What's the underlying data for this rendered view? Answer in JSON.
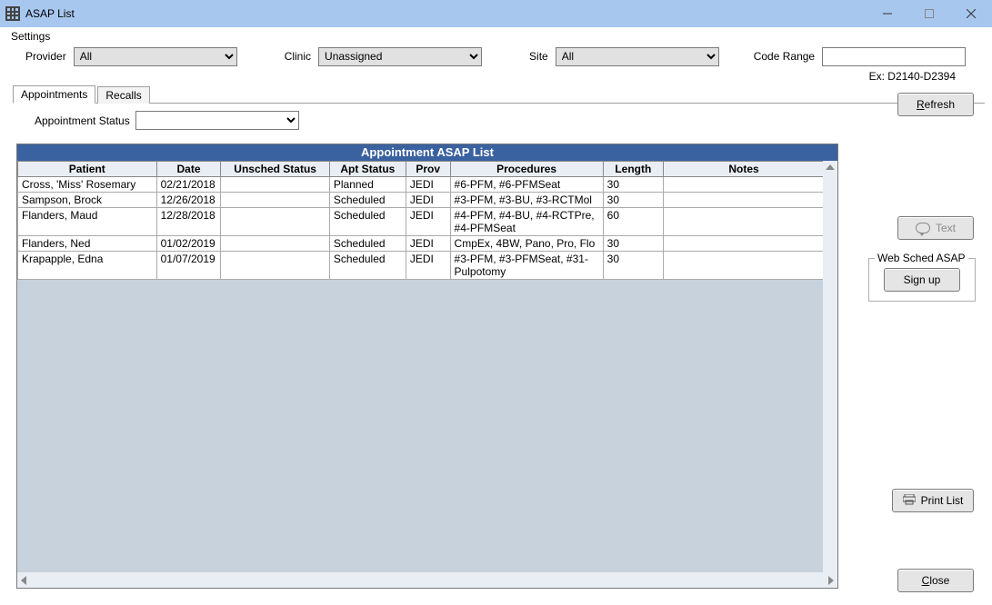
{
  "window": {
    "title": "ASAP List"
  },
  "menu": {
    "settings": "Settings"
  },
  "filters": {
    "provider_label": "Provider",
    "provider_value": "All",
    "clinic_label": "Clinic",
    "clinic_value": "Unassigned",
    "site_label": "Site",
    "site_value": "All",
    "coderange_label": "Code Range",
    "coderange_value": "",
    "coderange_example": "Ex: D2140-D2394"
  },
  "tabs": {
    "appointments": "Appointments",
    "recalls": "Recalls"
  },
  "apt_status": {
    "label": "Appointment Status",
    "value": ""
  },
  "grid": {
    "title": "Appointment ASAP List",
    "headers": {
      "patient": "Patient",
      "date": "Date",
      "unsched": "Unsched Status",
      "aptstat": "Apt Status",
      "prov": "Prov",
      "proc": "Procedures",
      "length": "Length",
      "notes": "Notes"
    },
    "rows": [
      {
        "patient": "Cross, 'Miss' Rosemary",
        "date": "02/21/2018",
        "unsched": "",
        "aptstat": "Planned",
        "prov": "JEDI",
        "proc": "#6-PFM, #6-PFMSeat",
        "length": "30",
        "notes": ""
      },
      {
        "patient": "Sampson, Brock",
        "date": "12/26/2018",
        "unsched": "",
        "aptstat": "Scheduled",
        "prov": "JEDI",
        "proc": "#3-PFM, #3-BU, #3-RCTMol",
        "length": "30",
        "notes": ""
      },
      {
        "patient": "Flanders, Maud",
        "date": "12/28/2018",
        "unsched": "",
        "aptstat": "Scheduled",
        "prov": "JEDI",
        "proc": "#4-PFM, #4-BU, #4-RCTPre, #4-PFMSeat",
        "length": "60",
        "notes": ""
      },
      {
        "patient": "Flanders, Ned",
        "date": "01/02/2019",
        "unsched": "",
        "aptstat": "Scheduled",
        "prov": "JEDI",
        "proc": "CmpEx, 4BW, Pano, Pro, Flo",
        "length": "30",
        "notes": ""
      },
      {
        "patient": "Krapapple, Edna",
        "date": "01/07/2019",
        "unsched": "",
        "aptstat": "Scheduled",
        "prov": "JEDI",
        "proc": "#3-PFM, #3-PFMSeat, #31-Pulpotomy",
        "length": "30",
        "notes": ""
      }
    ]
  },
  "buttons": {
    "refresh": "Refresh",
    "text": "Text",
    "signup": "Sign up",
    "printlist": "Print List",
    "close": "Close"
  },
  "websched": {
    "legend": "Web Sched ASAP"
  }
}
